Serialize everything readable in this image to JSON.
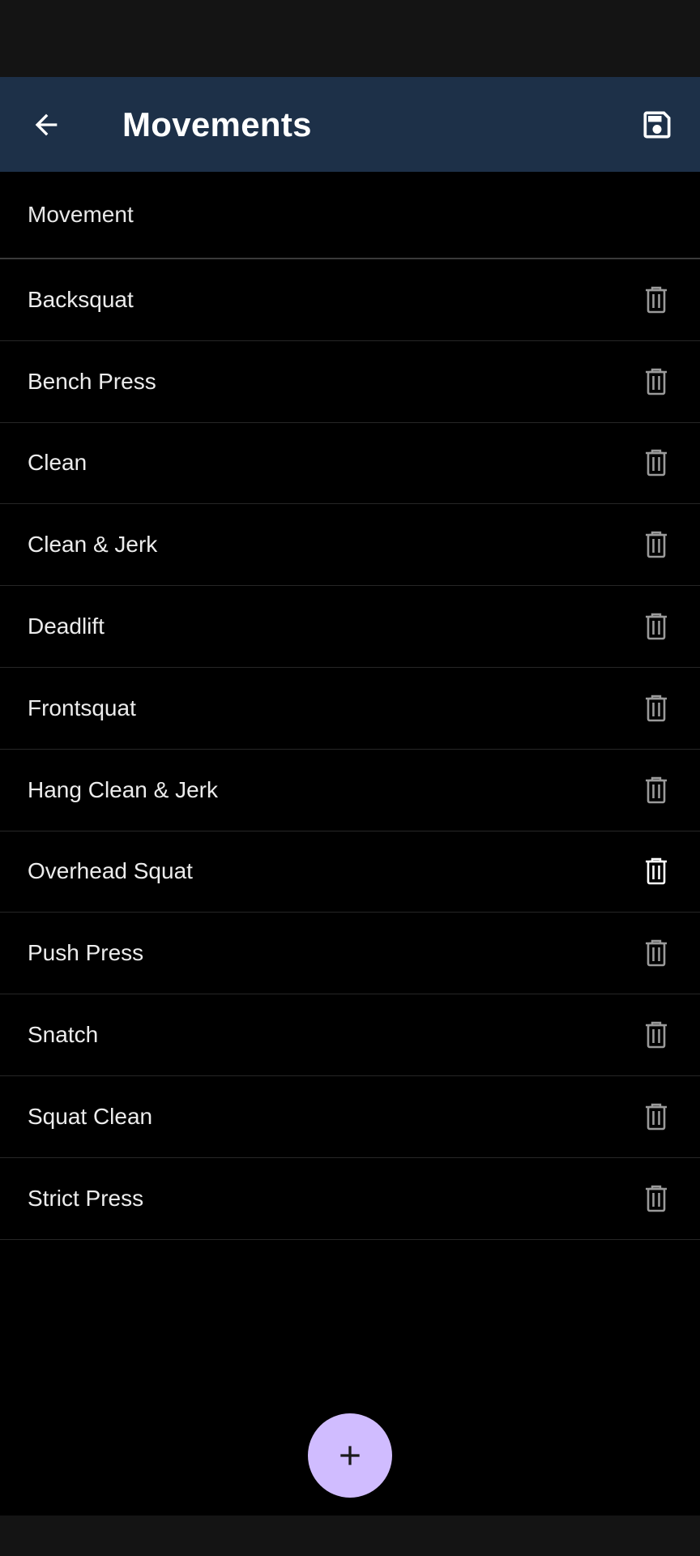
{
  "app_bar": {
    "title": "Movements",
    "back_icon": "arrow-left-icon",
    "save_icon": "save-icon"
  },
  "list": {
    "header": "Movement",
    "items": [
      {
        "label": "Backsquat"
      },
      {
        "label": "Bench Press"
      },
      {
        "label": "Clean"
      },
      {
        "label": "Clean & Jerk"
      },
      {
        "label": "Deadlift"
      },
      {
        "label": "Frontsquat"
      },
      {
        "label": "Hang Clean & Jerk"
      },
      {
        "label": "Overhead Squat"
      },
      {
        "label": "Push Press"
      },
      {
        "label": "Snatch"
      },
      {
        "label": "Squat Clean"
      },
      {
        "label": "Strict Press"
      }
    ],
    "delete_icon": "trash-icon",
    "highlighted_delete_item": "Overhead Squat"
  },
  "fab": {
    "icon": "plus-icon"
  },
  "colors": {
    "app_bar": "#1d3048",
    "background": "#000000",
    "fab": "#d0bcff",
    "icon_dim": "#9a9a9a",
    "icon_active": "#ffffff"
  }
}
